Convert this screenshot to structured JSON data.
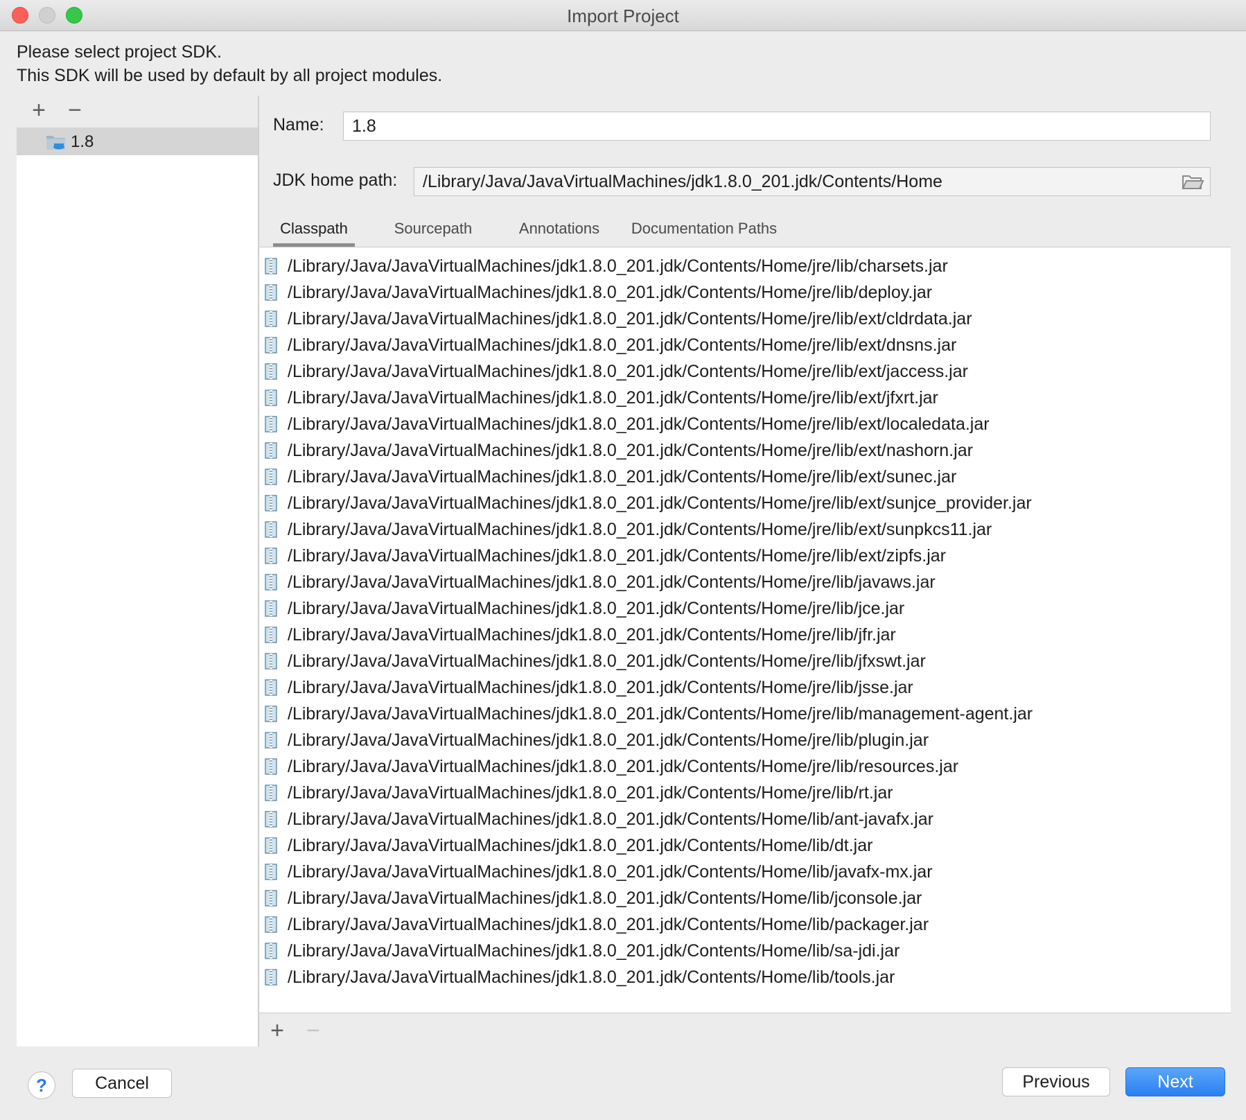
{
  "window": {
    "title": "Import Project"
  },
  "intro": {
    "line1": "Please select project SDK.",
    "line2": "This SDK will be used by default by all project modules."
  },
  "sdk_list": {
    "add_label": "+",
    "remove_label": "−",
    "items": [
      {
        "label": "1.8",
        "icon": "jdk-folder-icon",
        "selected": true
      }
    ]
  },
  "form": {
    "name_label": "Name:",
    "name_value": "1.8",
    "jdk_home_label": "JDK home path:",
    "jdk_home_value": "/Library/Java/JavaVirtualMachines/jdk1.8.0_201.jdk/Contents/Home"
  },
  "tabs": [
    {
      "label": "Classpath",
      "active": true
    },
    {
      "label": "Sourcepath",
      "active": false
    },
    {
      "label": "Annotations",
      "active": false
    },
    {
      "label": "Documentation Paths",
      "active": false
    }
  ],
  "classpath": {
    "items": [
      "/Library/Java/JavaVirtualMachines/jdk1.8.0_201.jdk/Contents/Home/jre/lib/charsets.jar",
      "/Library/Java/JavaVirtualMachines/jdk1.8.0_201.jdk/Contents/Home/jre/lib/deploy.jar",
      "/Library/Java/JavaVirtualMachines/jdk1.8.0_201.jdk/Contents/Home/jre/lib/ext/cldrdata.jar",
      "/Library/Java/JavaVirtualMachines/jdk1.8.0_201.jdk/Contents/Home/jre/lib/ext/dnsns.jar",
      "/Library/Java/JavaVirtualMachines/jdk1.8.0_201.jdk/Contents/Home/jre/lib/ext/jaccess.jar",
      "/Library/Java/JavaVirtualMachines/jdk1.8.0_201.jdk/Contents/Home/jre/lib/ext/jfxrt.jar",
      "/Library/Java/JavaVirtualMachines/jdk1.8.0_201.jdk/Contents/Home/jre/lib/ext/localedata.jar",
      "/Library/Java/JavaVirtualMachines/jdk1.8.0_201.jdk/Contents/Home/jre/lib/ext/nashorn.jar",
      "/Library/Java/JavaVirtualMachines/jdk1.8.0_201.jdk/Contents/Home/jre/lib/ext/sunec.jar",
      "/Library/Java/JavaVirtualMachines/jdk1.8.0_201.jdk/Contents/Home/jre/lib/ext/sunjce_provider.jar",
      "/Library/Java/JavaVirtualMachines/jdk1.8.0_201.jdk/Contents/Home/jre/lib/ext/sunpkcs11.jar",
      "/Library/Java/JavaVirtualMachines/jdk1.8.0_201.jdk/Contents/Home/jre/lib/ext/zipfs.jar",
      "/Library/Java/JavaVirtualMachines/jdk1.8.0_201.jdk/Contents/Home/jre/lib/javaws.jar",
      "/Library/Java/JavaVirtualMachines/jdk1.8.0_201.jdk/Contents/Home/jre/lib/jce.jar",
      "/Library/Java/JavaVirtualMachines/jdk1.8.0_201.jdk/Contents/Home/jre/lib/jfr.jar",
      "/Library/Java/JavaVirtualMachines/jdk1.8.0_201.jdk/Contents/Home/jre/lib/jfxswt.jar",
      "/Library/Java/JavaVirtualMachines/jdk1.8.0_201.jdk/Contents/Home/jre/lib/jsse.jar",
      "/Library/Java/JavaVirtualMachines/jdk1.8.0_201.jdk/Contents/Home/jre/lib/management-agent.jar",
      "/Library/Java/JavaVirtualMachines/jdk1.8.0_201.jdk/Contents/Home/jre/lib/plugin.jar",
      "/Library/Java/JavaVirtualMachines/jdk1.8.0_201.jdk/Contents/Home/jre/lib/resources.jar",
      "/Library/Java/JavaVirtualMachines/jdk1.8.0_201.jdk/Contents/Home/jre/lib/rt.jar",
      "/Library/Java/JavaVirtualMachines/jdk1.8.0_201.jdk/Contents/Home/lib/ant-javafx.jar",
      "/Library/Java/JavaVirtualMachines/jdk1.8.0_201.jdk/Contents/Home/lib/dt.jar",
      "/Library/Java/JavaVirtualMachines/jdk1.8.0_201.jdk/Contents/Home/lib/javafx-mx.jar",
      "/Library/Java/JavaVirtualMachines/jdk1.8.0_201.jdk/Contents/Home/lib/jconsole.jar",
      "/Library/Java/JavaVirtualMachines/jdk1.8.0_201.jdk/Contents/Home/lib/packager.jar",
      "/Library/Java/JavaVirtualMachines/jdk1.8.0_201.jdk/Contents/Home/lib/sa-jdi.jar",
      "/Library/Java/JavaVirtualMachines/jdk1.8.0_201.jdk/Contents/Home/lib/tools.jar"
    ],
    "add_label": "+",
    "remove_label": "−"
  },
  "footer": {
    "help_label": "?",
    "cancel_label": "Cancel",
    "previous_label": "Previous",
    "next_label": "Next"
  },
  "colors": {
    "window_bg": "#ececec",
    "selection_bg": "#d5d5d5",
    "primary_button": "#2b7ff2",
    "help_icon": "#2a7ae2",
    "close_light": "#fc605b",
    "maximize_light": "#35c84a"
  }
}
